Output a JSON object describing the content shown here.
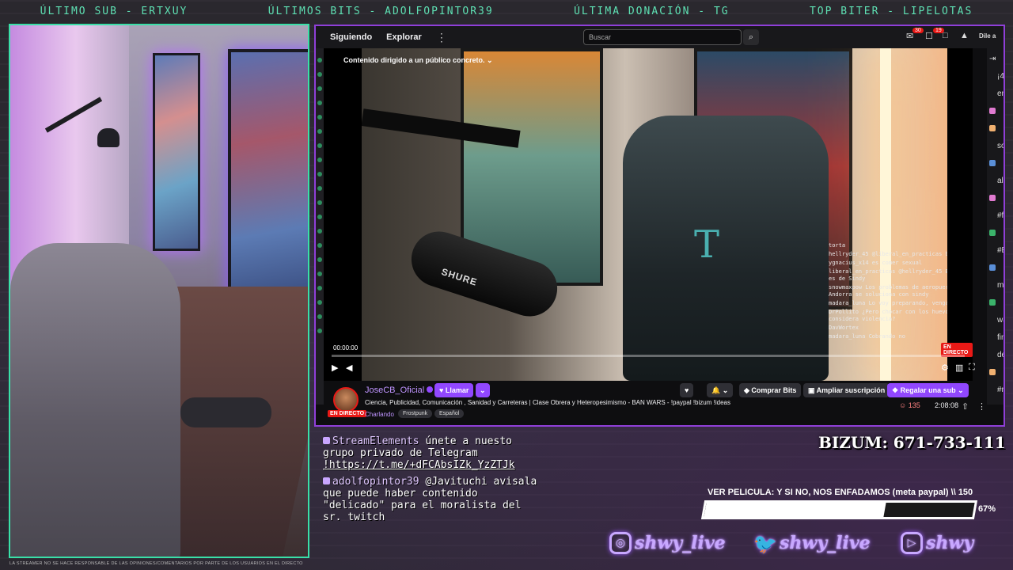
{
  "topbar": {
    "last_sub": "ÚLTIMO SUB - ERTXUY",
    "last_bits": "ÚLTIMOS BITS - ADOLFOPINTOR39",
    "last_donation": "ÚLTIMA DONACIÓN - TG",
    "top_biter": "TOP BITER - LIPELOTAS"
  },
  "disclaimer": "LA STREAMER NO SE HACE RESPONSABLE DE LAS OPINIONES/COMENTARIOS POR PARTE DE LOS USUARIOS EN EL DIRECTO",
  "twitch_nav": {
    "following": "Siguiendo",
    "browse": "Explorar",
    "more": "⋮",
    "search_placeholder": "Buscar",
    "notifications_count": "30",
    "whispers_count": "19",
    "prime_label": "Dile a"
  },
  "video": {
    "content_notice": "Contenido dirigido a un público concreto.",
    "time": "00:00:00",
    "live_label": "EN DIRECTO",
    "mic_brand": "SHURE",
    "chair_letter": "T",
    "overlay_chat": [
      "torta",
      "hellryder_45 @liberal_en_practicas bien traido",
      "ygnacius_x14 es comer sexual",
      "liberal_en_practicas @hellryder_45 El mérito es de Sindy",
      "snowmaxpow Los problemas de aeropuerto en Andorra se soluciona con sindy",
      "madara_luna Lo voy preparando, venga",
      "DrPollito ¿Pero chocar con los huevos se considera violencia?",
      "DavWortex",
      "madara_luna Cobrando no"
    ]
  },
  "channel": {
    "name": "JoseCB_Oficial",
    "live_label": "EN DIRECTO",
    "call_button": "Llamar",
    "buy_bits": "Comprar Bits",
    "upgrade_sub": "Ampliar suscripción",
    "gift_sub": "Regalar una sub",
    "title": "Ciencia, Publicidad, Comunicación , Sanidad y Carreteras | Clase Obrera y Heteropesimismo - BAN WARS - !paypal !bizum !ideas",
    "category": "Charlando",
    "tags": [
      "Frostpunk",
      "Español"
    ],
    "viewers": "135",
    "uptime": "2:08:08"
  },
  "side_chat": [
    {
      "text": "¡45",
      "color": "#ffffff"
    },
    {
      "text": "em",
      "color": "#ffffff"
    },
    {
      "text": "",
      "color": "#e07ad0"
    },
    {
      "text": "",
      "color": "#f0b070"
    },
    {
      "text": "sor",
      "color": "#ffffff"
    },
    {
      "text": "",
      "color": "#5a8fd8"
    },
    {
      "text": "alg",
      "color": "#ffffff"
    },
    {
      "text": "",
      "color": "#e07ad0"
    },
    {
      "text": "#fo",
      "color": "#ffffff"
    },
    {
      "text": "",
      "color": "#3bb36b"
    },
    {
      "text": "#Es",
      "color": "#ffffff"
    },
    {
      "text": "",
      "color": "#5a8fd8"
    },
    {
      "text": "mu",
      "color": "#ffffff"
    },
    {
      "text": "",
      "color": "#3bb36b"
    },
    {
      "text": "wa",
      "color": "#ffffff"
    },
    {
      "text": "fina",
      "color": "#ffffff"
    },
    {
      "text": "de",
      "color": "#ffffff"
    },
    {
      "text": "",
      "color": "#f0b070"
    },
    {
      "text": "#m",
      "color": "#ffffff"
    }
  ],
  "stream_chat": [
    {
      "user": "StreamElements",
      "text": "únete a nuesto grupo privado de Telegram",
      "link": "!https://t.me/+dFCAbsIZk_YzZTJk"
    },
    {
      "user": "adolfopintor39",
      "text": "@Javituchi avisala que puede haber contenido \"delicado\" para el moralista del sr. twitch",
      "link": ""
    }
  ],
  "bizum": "BIZUM: 671-733-111",
  "goal": {
    "title": "VER PELICULA: Y SI NO, NOS ENFADAMOS (meta paypal) \\\\ 150",
    "percent_label": "67%",
    "fraction": 0.67
  },
  "socials": [
    {
      "icon": "instagram-icon",
      "handle": "shwy_live"
    },
    {
      "icon": "twitter-icon",
      "handle": "shwy_live"
    },
    {
      "icon": "youtube-icon",
      "handle": "shwy"
    }
  ]
}
